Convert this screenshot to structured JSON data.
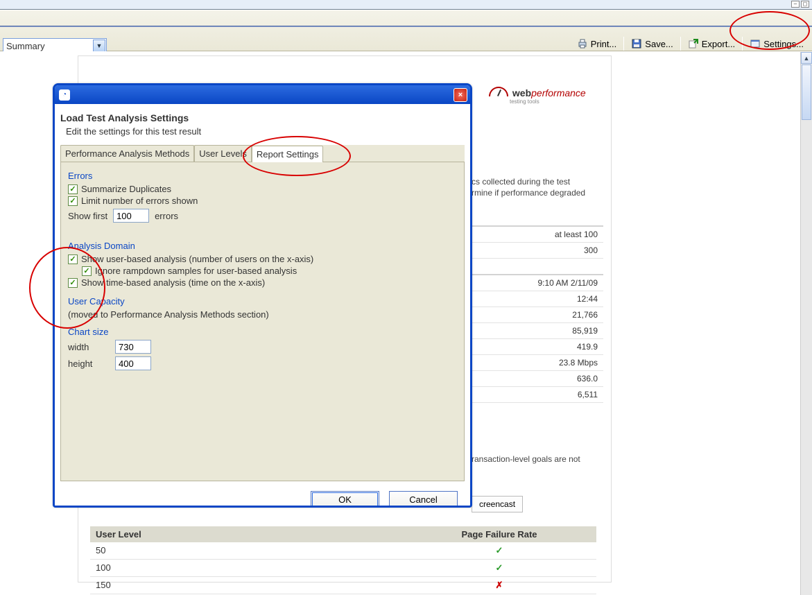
{
  "toolbar": {
    "dropdown_value": "Summary",
    "print_label": "Print...",
    "save_label": "Save...",
    "export_label": "Export...",
    "settings_label": "Settings..."
  },
  "logo": {
    "brand_left": "web",
    "brand_right": "performance",
    "tagline": "testing tools"
  },
  "report": {
    "desc_frag1": "cs collected during the test",
    "desc_frag2": "rmine if performance degraded",
    "stats": {
      "at_least": "at least 100",
      "val_300": "300",
      "time": "9:10 AM 2/11/09",
      "dur": "12:44",
      "v1": "21,766",
      "v2": "85,919",
      "v3": "419.9",
      "v4": "23.8 Mbps",
      "v5": "636.0",
      "v6": "6,511"
    },
    "goal_note": "ransaction-level goals are not",
    "screencast_label": "creencast",
    "failure_header_user": "User Level",
    "failure_header_rate": "Page Failure Rate",
    "rows": {
      "r1": "50",
      "r2": "100",
      "r3": "150"
    }
  },
  "dialog": {
    "title": "Load Test Analysis Settings",
    "subtitle": "Edit the settings for this test result",
    "tabs": {
      "perf": "Performance Analysis Methods",
      "users": "User Levels",
      "report": "Report Settings"
    },
    "errors": {
      "heading": "Errors",
      "summarize": "Summarize Duplicates",
      "limit": "Limit number of errors shown",
      "show_first": "Show first",
      "show_first_val": "100",
      "errors_word": "errors"
    },
    "domain": {
      "heading": "Analysis Domain",
      "user_based": "Show user-based analysis (number of users on the x-axis)",
      "ignore_ramp": "Ignore rampdown samples for user-based analysis",
      "time_based": "Show time-based analysis (time on the x-axis)"
    },
    "capacity": {
      "heading": "User Capacity",
      "note": "(moved to Performance Analysis Methods section)"
    },
    "chart": {
      "heading": "Chart size",
      "width_label": "width",
      "width_val": "730",
      "height_label": "height",
      "height_val": "400"
    },
    "ok": "OK",
    "cancel": "Cancel"
  }
}
